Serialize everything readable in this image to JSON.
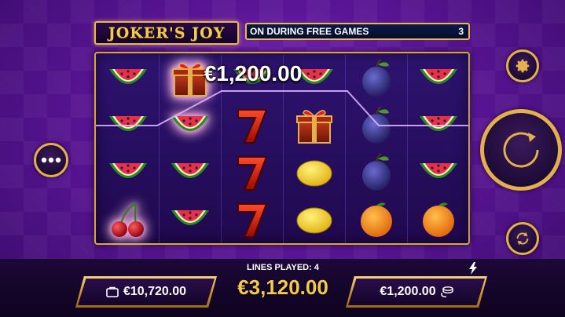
{
  "game": {
    "logo_text": "JOKER'S JOY",
    "marquee_text": "ON DURING FREE GAMES",
    "marquee_count": "3"
  },
  "reels": [
    [
      "watermelon",
      "watermelon",
      "watermelon",
      "cherry"
    ],
    [
      "gift",
      "watermelon",
      "watermelon",
      "watermelon"
    ],
    [
      "watermelon",
      "seven",
      "seven",
      "seven"
    ],
    [
      "watermelon",
      "gift",
      "lemon",
      "lemon"
    ],
    [
      "plum",
      "plum",
      "plum",
      "orange"
    ],
    [
      "watermelon",
      "watermelon",
      "watermelon",
      "orange"
    ]
  ],
  "win": {
    "amount": "€1,200.00"
  },
  "footer": {
    "lines_played": "LINES PLAYED: 4",
    "total_win": "€3,120.00",
    "balance": "€10,720.00",
    "bet": "€1,200.00"
  },
  "icons": {
    "settings": "gear-icon",
    "spin": "spin-arrow-icon",
    "autoplay": "autoplay-icon",
    "menu": "more-icon",
    "balance": "wallet-icon",
    "bet": "coins-icon",
    "turbo": "lightning-icon"
  },
  "colors": {
    "gold": "#e3b04c",
    "text_gold": "#f3c94f",
    "background": "#5a1596"
  }
}
